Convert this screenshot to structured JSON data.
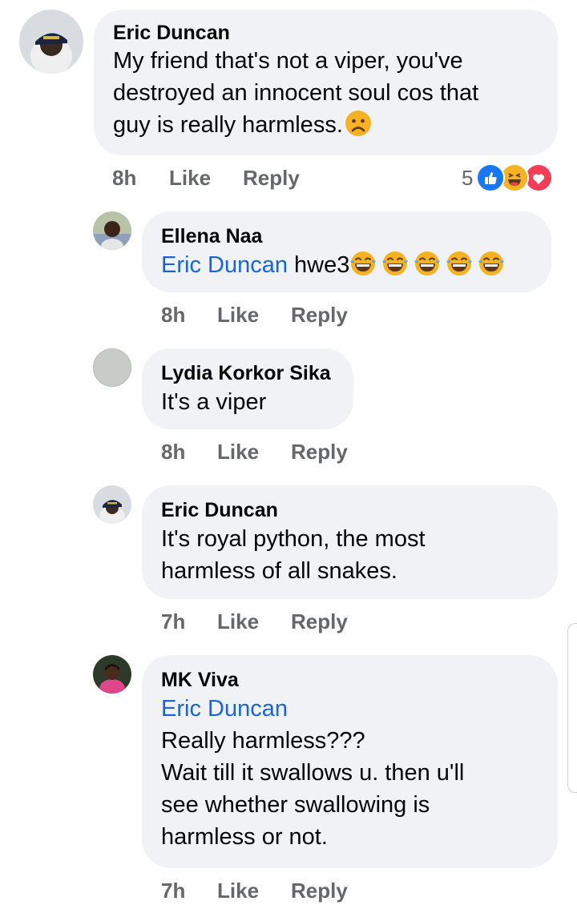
{
  "comments": [
    {
      "author": "Eric Duncan",
      "text_lines": [
        "My friend that's not a viper, you've",
        "destroyed an innocent soul cos that",
        "guy is really harmless."
      ],
      "emoji_after": "frowning-face",
      "time": "8h",
      "like": "Like",
      "reply": "Reply",
      "reactions": {
        "count": "5",
        "types": [
          "like",
          "haha",
          "love"
        ]
      }
    },
    {
      "author": "Ellena Naa",
      "mention": "Eric Duncan",
      "text": "hwe3",
      "emoji_after": "tears-of-joy",
      "emoji_count": 5,
      "time": "8h",
      "like": "Like",
      "reply": "Reply"
    },
    {
      "author": "Lydia Korkor Sika",
      "text": "It's a viper",
      "time": "8h",
      "like": "Like",
      "reply": "Reply"
    },
    {
      "author": "Eric Duncan",
      "text_lines": [
        "It's royal python, the most",
        "harmless of all snakes."
      ],
      "time": "7h",
      "like": "Like",
      "reply": "Reply"
    },
    {
      "author": "MK Viva",
      "mention": "Eric Duncan",
      "text_lines": [
        "Really harmless???",
        "Wait till it swallows u. then u'll",
        "see whether swallowing is",
        "harmless or not."
      ],
      "time": "7h",
      "like": "Like",
      "reply": "Reply"
    }
  ],
  "colors": {
    "bubble": "#f0f2f5",
    "meta_text": "#65676b",
    "mention": "#1b64d6",
    "like_reaction": "#1877f2",
    "love_reaction": "#f33e58",
    "haha_reaction": "#f7b125"
  }
}
